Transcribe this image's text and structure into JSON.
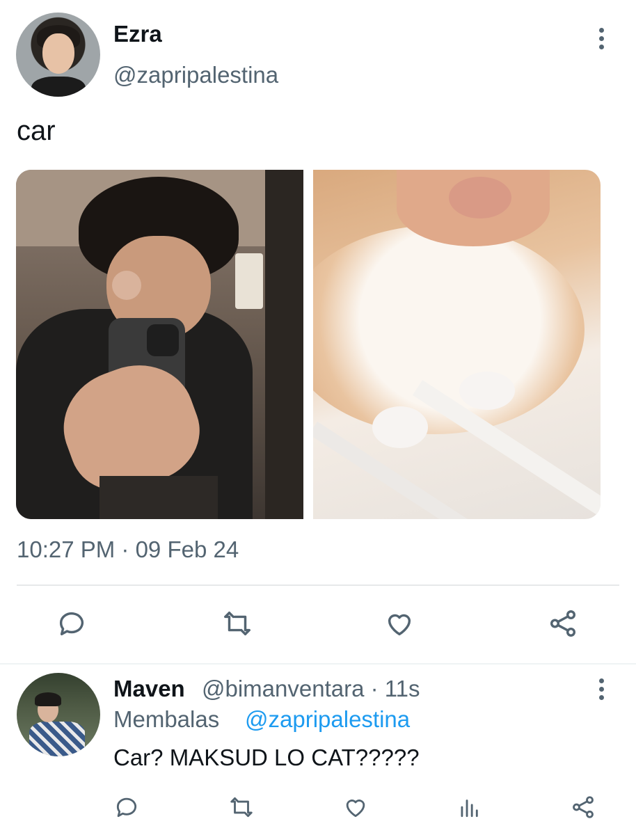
{
  "tweet": {
    "author_name": "Ezra",
    "author_handle": "@zapripalestina",
    "text": "car",
    "timestamp": "10:27 PM · 09 Feb 24",
    "media": [
      {
        "description": "mirror selfie"
      },
      {
        "description": "cat chin close-up"
      }
    ],
    "actions": [
      "reply-icon",
      "retweet-icon",
      "like-icon",
      "share-icon"
    ]
  },
  "reply": {
    "author_name": "Maven",
    "author_handle_time": "@bimanventara · 11s",
    "reply_label": "Membalas",
    "reply_to": "@zapripalestina",
    "text": "Car? MAKSUD LO CAT?????",
    "actions": [
      "reply-icon",
      "retweet-icon",
      "like-icon",
      "analytics-icon",
      "share-icon"
    ]
  },
  "colors": {
    "text_primary": "#0f1419",
    "text_secondary": "#536471",
    "link": "#1d9bf0",
    "divider": "#e6e8ea"
  }
}
